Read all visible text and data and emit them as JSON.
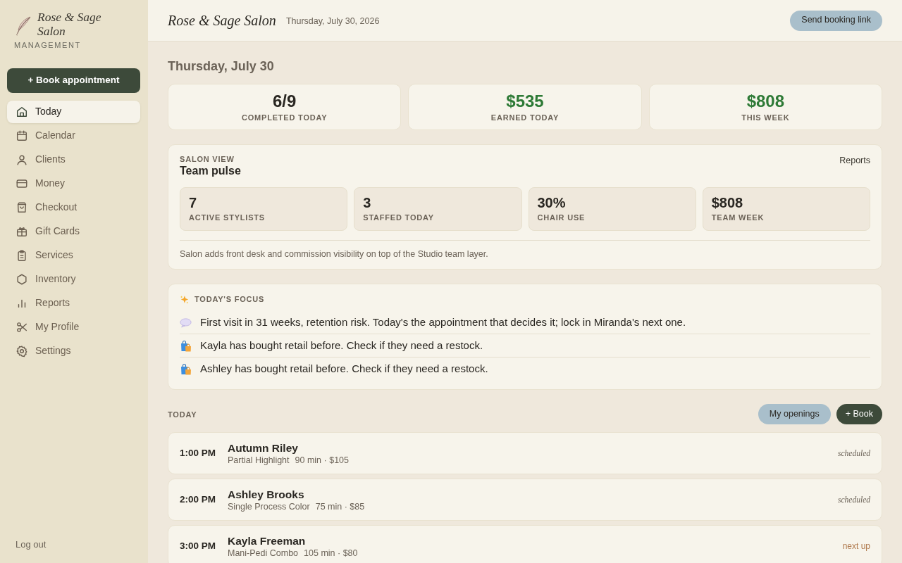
{
  "sidebar": {
    "brand": "Rose & Sage Salon",
    "subtitle": "MANAGEMENT",
    "primary_action": "+ Book appointment",
    "items": [
      {
        "label": "Today",
        "selected": true
      },
      {
        "label": "Calendar",
        "selected": false
      },
      {
        "label": "Clients",
        "selected": false
      },
      {
        "label": "Money",
        "selected": false
      },
      {
        "label": "Checkout",
        "selected": false
      },
      {
        "label": "Gift Cards",
        "selected": false
      },
      {
        "label": "Services",
        "selected": false
      },
      {
        "label": "Inventory",
        "selected": false
      },
      {
        "label": "Reports",
        "selected": false
      },
      {
        "label": "My Profile",
        "selected": false
      },
      {
        "label": "Settings",
        "selected": false
      }
    ],
    "footer_link": "Log out"
  },
  "header": {
    "title": "Rose & Sage Salon",
    "date": "Thursday, July 30, 2026",
    "action": "Send booking link"
  },
  "day_heading": "Thursday, July 30",
  "stats": [
    {
      "value": "6/9",
      "label": "COMPLETED TODAY",
      "kind": "count"
    },
    {
      "value": "$535",
      "label": "EARNED TODAY",
      "kind": "money"
    },
    {
      "value": "$808",
      "label": "THIS WEEK",
      "kind": "money"
    }
  ],
  "team_pulse": {
    "eyebrow": "SALON VIEW",
    "title": "Team pulse",
    "link": "Reports",
    "tiles": [
      {
        "value": "7",
        "label": "ACTIVE STYLISTS"
      },
      {
        "value": "3",
        "label": "STAFFED TODAY"
      },
      {
        "value": "30%",
        "label": "CHAIR USE"
      },
      {
        "value": "$808",
        "label": "TEAM WEEK"
      }
    ],
    "note": "Salon adds front desk and commission visibility on top of the Studio team layer."
  },
  "focus": {
    "title": "TODAY'S FOCUS",
    "items": [
      {
        "kind": "retention",
        "text": "First visit in 31 weeks, retention risk. Today's the appointment that decides it; lock in Miranda's next one."
      },
      {
        "kind": "retail",
        "text": "Kayla has bought retail before. Check if they need a restock."
      },
      {
        "kind": "retail",
        "text": "Ashley has bought retail before. Check if they need a restock."
      }
    ]
  },
  "today": {
    "title": "TODAY",
    "buttons": [
      {
        "label": "My openings",
        "kind": "secondary"
      },
      {
        "label": "+ Book",
        "kind": "primary"
      }
    ],
    "appointments": [
      {
        "time": "1:00 PM",
        "client": "Autumn Riley",
        "service": "Partial Highlight",
        "details": "90 min · $105",
        "status": "scheduled",
        "kind": "scheduled"
      },
      {
        "time": "2:00 PM",
        "client": "Ashley Brooks",
        "service": "Single Process Color",
        "details": "75 min · $85",
        "status": "scheduled",
        "kind": "scheduled"
      },
      {
        "time": "3:00 PM",
        "client": "Kayla Freeman",
        "service": "Mani-Pedi Combo",
        "details": "105 min · $80",
        "status": "next up",
        "kind": "next"
      }
    ]
  }
}
